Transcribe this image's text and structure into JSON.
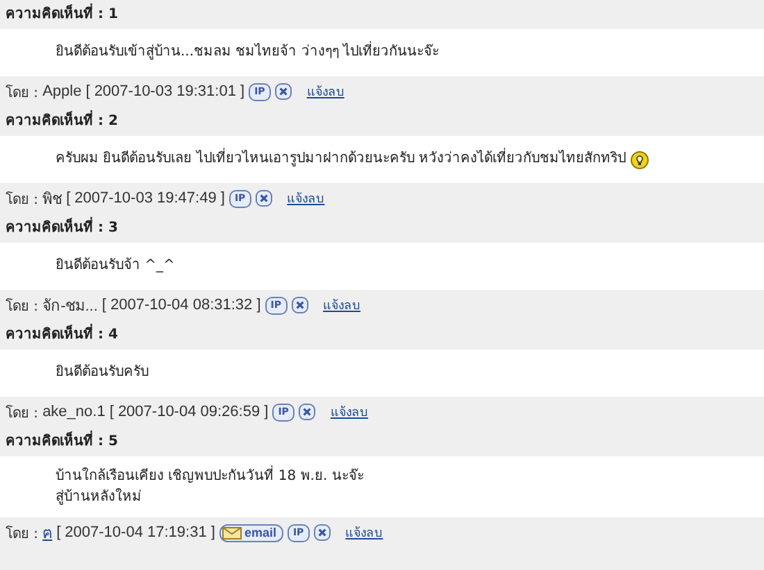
{
  "comments": [
    {
      "heading": "ความคิดเห็นที่ : 1",
      "body": [
        "ยินดีต้อนรับเข้าสู่บ้าน...ชมลม ชมไทยจ้า ว่างๆๆ ไปเที่ยวกันนะจ๊ะ"
      ],
      "emoticon": false,
      "by": "โดย :",
      "author": "Apple",
      "author_linked": false,
      "time": "[ 2007-10-03 19:31:01 ]",
      "ip": "IP",
      "report": "แจ้งลบ"
    },
    {
      "heading": "ความคิดเห็นที่ : 2",
      "body": [
        "ครับผม ยินดีต้อนรับเลย ไปเที่ยวไหนเอารูปมาฝากด้วยนะครับ หวังว่าคงได้เที่ยวกับชมไทยสักทริป"
      ],
      "emoticon": true,
      "by": "โดย :",
      "author": "พิช",
      "author_linked": false,
      "time": "[ 2007-10-03 19:47:49 ]",
      "ip": "IP",
      "report": "แจ้งลบ"
    },
    {
      "heading": "ความคิดเห็นที่ : 3",
      "body": [
        "ยินดีต้อนรับจ้า ^_^"
      ],
      "emoticon": false,
      "by": "โดย :",
      "author": "จัก-ชม...",
      "author_linked": false,
      "time": "[ 2007-10-04 08:31:32 ]",
      "ip": "IP",
      "report": "แจ้งลบ"
    },
    {
      "heading": "ความคิดเห็นที่ : 4",
      "body": [
        "ยินดีต้อนรับครับ"
      ],
      "emoticon": false,
      "by": "โดย :",
      "author": "ake_no.1",
      "author_linked": false,
      "time": "[ 2007-10-04 09:26:59 ]",
      "ip": "IP",
      "report": "แจ้งลบ"
    },
    {
      "heading": "ความคิดเห็นที่ : 5",
      "body": [
        "บ้านใกล้เรือนเคียง เชิญพบปะกันวันที่ 18 พ.ย. นะจ๊ะ",
        "สู่บ้านหลังใหม่"
      ],
      "emoticon": false,
      "by": "โดย :",
      "author": "ฅ",
      "author_linked": true,
      "time": "[ 2007-10-04 17:19:31 ]",
      "email": "email",
      "ip": "IP",
      "report": "แจ้งลบ"
    }
  ]
}
